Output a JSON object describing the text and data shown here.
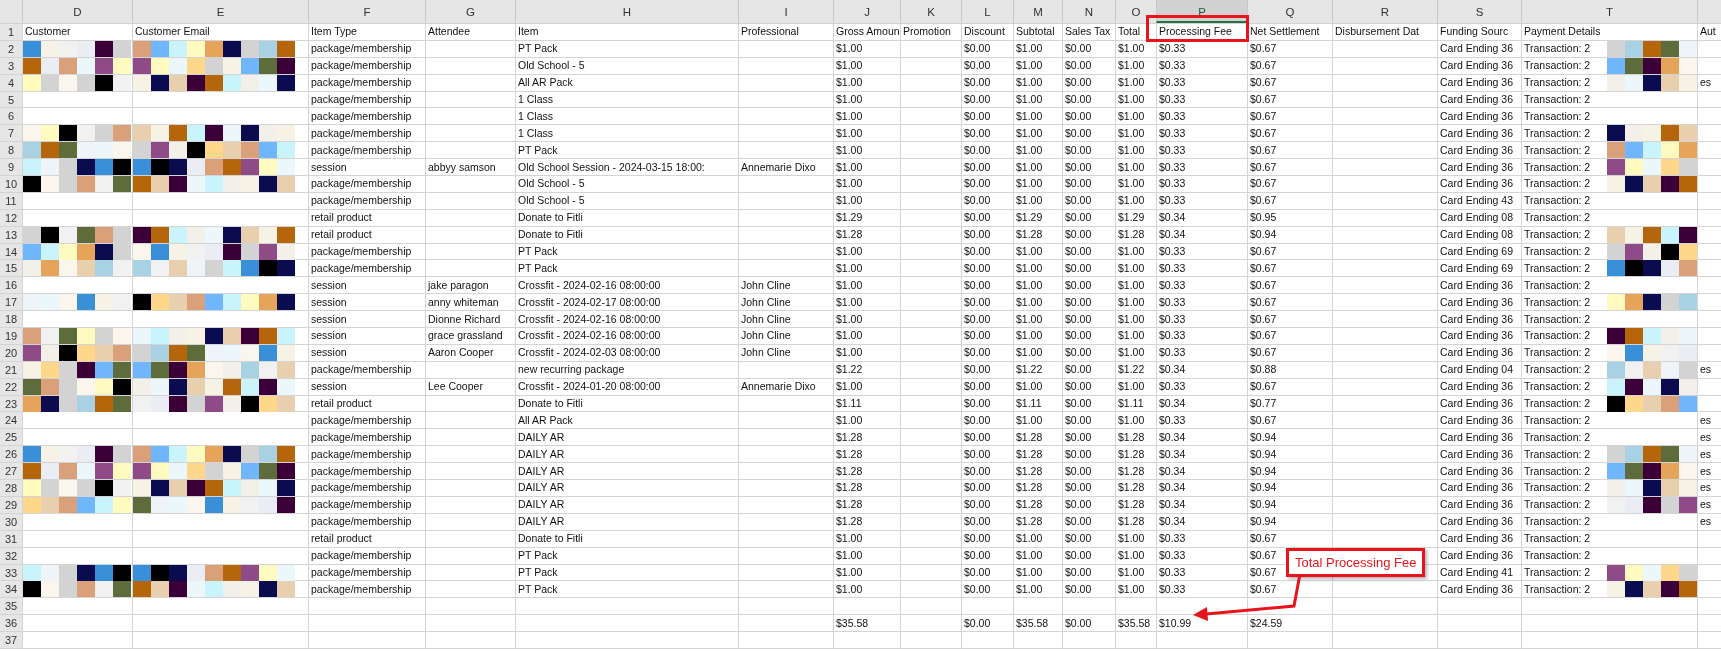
{
  "column_letters": [
    {
      "label": "D",
      "selected": false
    },
    {
      "label": "E",
      "selected": false
    },
    {
      "label": "F",
      "selected": false
    },
    {
      "label": "G",
      "selected": false
    },
    {
      "label": "H",
      "selected": false
    },
    {
      "label": "I",
      "selected": false
    },
    {
      "label": "J",
      "selected": false
    },
    {
      "label": "K",
      "selected": false
    },
    {
      "label": "L",
      "selected": false
    },
    {
      "label": "M",
      "selected": false
    },
    {
      "label": "N",
      "selected": false
    },
    {
      "label": "O",
      "selected": false
    },
    {
      "label": "P",
      "selected": true
    },
    {
      "label": "Q",
      "selected": false
    },
    {
      "label": "R",
      "selected": false
    },
    {
      "label": "S",
      "selected": false
    },
    {
      "label": "T",
      "selected": false
    }
  ],
  "header_row": {
    "number": "1",
    "customer": "Customer",
    "customer_email": "Customer Email",
    "item_type": "Item Type",
    "attendee": "Attendee",
    "item": "Item",
    "professional": "Professional",
    "gross_amount": "Gross Amoun",
    "promotion": "Promotion",
    "discount": "Discount",
    "subtotal": "Subtotal",
    "sales_tax": "Sales Tax",
    "total": "Total",
    "processing_fee": "Processing Fee",
    "net_settlement": "Net Settlement",
    "disbursement_date": "Disbursement Dat",
    "funding_source": "Funding Sourc",
    "payment_details": "Payment Details",
    "column_u": "Aut"
  },
  "rows": [
    {
      "number": "2",
      "redacted": true,
      "item_type": "package/membership",
      "item": "PT Pack",
      "gross_amount": "$1.00",
      "discount": "$0.00",
      "subtotal": "$1.00",
      "sales_tax": "$0.00",
      "total": "$1.00",
      "processing_fee": "$0.33",
      "net_settlement": "$0.67",
      "funding_source": "Card Ending 36",
      "payment_details": "Transaction: 2"
    },
    {
      "number": "3",
      "redacted": true,
      "item_type": "package/membership",
      "item": "Old School - 5",
      "gross_amount": "$1.00",
      "discount": "$0.00",
      "subtotal": "$1.00",
      "sales_tax": "$0.00",
      "total": "$1.00",
      "processing_fee": "$0.33",
      "net_settlement": "$0.67",
      "funding_source": "Card Ending 36",
      "payment_details": "Transaction: 2"
    },
    {
      "number": "4",
      "redacted": true,
      "item_type": "package/membership",
      "item": "All AR Pack",
      "gross_amount": "$1.00",
      "discount": "$0.00",
      "subtotal": "$1.00",
      "sales_tax": "$0.00",
      "total": "$1.00",
      "processing_fee": "$0.33",
      "net_settlement": "$0.67",
      "funding_source": "Card Ending 36",
      "payment_details": "Transaction: 2",
      "column_u": "es"
    },
    {
      "number": "5",
      "redacted": false,
      "item_type": "package/membership",
      "item": "1 Class",
      "gross_amount": "$1.00",
      "discount": "$0.00",
      "subtotal": "$1.00",
      "sales_tax": "$0.00",
      "total": "$1.00",
      "processing_fee": "$0.33",
      "net_settlement": "$0.67",
      "funding_source": "Card Ending 36",
      "payment_details": "Transaction: 2"
    },
    {
      "number": "6",
      "redacted": false,
      "item_type": "package/membership",
      "item": "1 Class",
      "gross_amount": "$1.00",
      "discount": "$0.00",
      "subtotal": "$1.00",
      "sales_tax": "$0.00",
      "total": "$1.00",
      "processing_fee": "$0.33",
      "net_settlement": "$0.67",
      "funding_source": "Card Ending 36",
      "payment_details": "Transaction: 2"
    },
    {
      "number": "7",
      "redacted": true,
      "item_type": "package/membership",
      "item": "1 Class",
      "gross_amount": "$1.00",
      "discount": "$0.00",
      "subtotal": "$1.00",
      "sales_tax": "$0.00",
      "total": "$1.00",
      "processing_fee": "$0.33",
      "net_settlement": "$0.67",
      "funding_source": "Card Ending 36",
      "payment_details": "Transaction: 2"
    },
    {
      "number": "8",
      "redacted": true,
      "item_type": "package/membership",
      "item": "PT Pack",
      "gross_amount": "$1.00",
      "discount": "$0.00",
      "subtotal": "$1.00",
      "sales_tax": "$0.00",
      "total": "$1.00",
      "processing_fee": "$0.33",
      "net_settlement": "$0.67",
      "funding_source": "Card Ending 36",
      "payment_details": "Transaction: 2"
    },
    {
      "number": "9",
      "redacted": true,
      "item_type": "session",
      "attendee": "abbyy samson",
      "item": "Old School Session - 2024-03-15 18:00:",
      "professional": "Annemarie Dixo",
      "gross_amount": "$1.00",
      "discount": "$0.00",
      "subtotal": "$1.00",
      "sales_tax": "$0.00",
      "total": "$1.00",
      "processing_fee": "$0.33",
      "net_settlement": "$0.67",
      "funding_source": "Card Ending 36",
      "payment_details": "Transaction: 2"
    },
    {
      "number": "10",
      "redacted": true,
      "item_type": "package/membership",
      "item": "Old School - 5",
      "gross_amount": "$1.00",
      "discount": "$0.00",
      "subtotal": "$1.00",
      "sales_tax": "$0.00",
      "total": "$1.00",
      "processing_fee": "$0.33",
      "net_settlement": "$0.67",
      "funding_source": "Card Ending 36",
      "payment_details": "Transaction: 2"
    },
    {
      "number": "11",
      "redacted": false,
      "item_type": "package/membership",
      "item": "Old School - 5",
      "gross_amount": "$1.00",
      "discount": "$0.00",
      "subtotal": "$1.00",
      "sales_tax": "$0.00",
      "total": "$1.00",
      "processing_fee": "$0.33",
      "net_settlement": "$0.67",
      "funding_source": "Card Ending 43",
      "payment_details": "Transaction: 2"
    },
    {
      "number": "12",
      "redacted": false,
      "item_type": "retail product",
      "item": "Donate to Fitli",
      "gross_amount": "$1.29",
      "discount": "$0.00",
      "subtotal": "$1.29",
      "sales_tax": "$0.00",
      "total": "$1.29",
      "processing_fee": "$0.34",
      "net_settlement": "$0.95",
      "funding_source": "Card Ending 08",
      "payment_details": "Transaction: 2"
    },
    {
      "number": "13",
      "redacted": true,
      "item_type": "retail product",
      "item": "Donate to Fitli",
      "gross_amount": "$1.28",
      "discount": "$0.00",
      "subtotal": "$1.28",
      "sales_tax": "$0.00",
      "total": "$1.28",
      "processing_fee": "$0.34",
      "net_settlement": "$0.94",
      "funding_source": "Card Ending 08",
      "payment_details": "Transaction: 2"
    },
    {
      "number": "14",
      "redacted": true,
      "item_type": "package/membership",
      "item": "PT Pack",
      "gross_amount": "$1.00",
      "discount": "$0.00",
      "subtotal": "$1.00",
      "sales_tax": "$0.00",
      "total": "$1.00",
      "processing_fee": "$0.33",
      "net_settlement": "$0.67",
      "funding_source": "Card Ending 69",
      "payment_details": "Transaction: 2"
    },
    {
      "number": "15",
      "redacted": true,
      "item_type": "package/membership",
      "item": "PT Pack",
      "gross_amount": "$1.00",
      "discount": "$0.00",
      "subtotal": "$1.00",
      "sales_tax": "$0.00",
      "total": "$1.00",
      "processing_fee": "$0.33",
      "net_settlement": "$0.67",
      "funding_source": "Card Ending 69",
      "payment_details": "Transaction: 2"
    },
    {
      "number": "16",
      "redacted": false,
      "item_type": "session",
      "attendee": "jake paragon",
      "item": "Crossfit - 2024-02-16 08:00:00",
      "professional": "John Cline",
      "gross_amount": "$1.00",
      "discount": "$0.00",
      "subtotal": "$1.00",
      "sales_tax": "$0.00",
      "total": "$1.00",
      "processing_fee": "$0.33",
      "net_settlement": "$0.67",
      "funding_source": "Card Ending 36",
      "payment_details": "Transaction: 2"
    },
    {
      "number": "17",
      "redacted": true,
      "item_type": "session",
      "attendee": "anny whiteman",
      "item": "Crossfit - 2024-02-17 08:00:00",
      "professional": "John Cline",
      "gross_amount": "$1.00",
      "discount": "$0.00",
      "subtotal": "$1.00",
      "sales_tax": "$0.00",
      "total": "$1.00",
      "processing_fee": "$0.33",
      "net_settlement": "$0.67",
      "funding_source": "Card Ending 36",
      "payment_details": "Transaction: 2"
    },
    {
      "number": "18",
      "redacted": false,
      "item_type": "session",
      "attendee": "Dionne Richard",
      "item": "Crossfit - 2024-02-16 08:00:00",
      "professional": "John Cline",
      "gross_amount": "$1.00",
      "discount": "$0.00",
      "subtotal": "$1.00",
      "sales_tax": "$0.00",
      "total": "$1.00",
      "processing_fee": "$0.33",
      "net_settlement": "$0.67",
      "funding_source": "Card Ending 36",
      "payment_details": "Transaction: 2"
    },
    {
      "number": "19",
      "redacted": true,
      "item_type": "session",
      "attendee": "grace grassland",
      "item": "Crossfit - 2024-02-16 08:00:00",
      "professional": "John Cline",
      "gross_amount": "$1.00",
      "discount": "$0.00",
      "subtotal": "$1.00",
      "sales_tax": "$0.00",
      "total": "$1.00",
      "processing_fee": "$0.33",
      "net_settlement": "$0.67",
      "funding_source": "Card Ending 36",
      "payment_details": "Transaction: 2"
    },
    {
      "number": "20",
      "redacted": true,
      "item_type": "session",
      "attendee": "Aaron Cooper",
      "item": "Crossfit - 2024-02-03 08:00:00",
      "professional": "John Cline",
      "gross_amount": "$1.00",
      "discount": "$0.00",
      "subtotal": "$1.00",
      "sales_tax": "$0.00",
      "total": "$1.00",
      "processing_fee": "$0.33",
      "net_settlement": "$0.67",
      "funding_source": "Card Ending 36",
      "payment_details": "Transaction: 2"
    },
    {
      "number": "21",
      "redacted": true,
      "item_type": "package/membership",
      "item": "new recurring package",
      "gross_amount": "$1.22",
      "discount": "$0.00",
      "subtotal": "$1.22",
      "sales_tax": "$0.00",
      "total": "$1.22",
      "processing_fee": "$0.34",
      "net_settlement": "$0.88",
      "funding_source": "Card Ending 04",
      "payment_details": "Transaction: 2",
      "column_u": "es"
    },
    {
      "number": "22",
      "redacted": true,
      "item_type": "session",
      "attendee": "Lee Cooper",
      "item": "Crossfit - 2024-01-20 08:00:00",
      "professional": "Annemarie Dixo",
      "gross_amount": "$1.00",
      "discount": "$0.00",
      "subtotal": "$1.00",
      "sales_tax": "$0.00",
      "total": "$1.00",
      "processing_fee": "$0.33",
      "net_settlement": "$0.67",
      "funding_source": "Card Ending 36",
      "payment_details": "Transaction: 2"
    },
    {
      "number": "23",
      "redacted": true,
      "item_type": "retail product",
      "item": "Donate to Fitli",
      "gross_amount": "$1.11",
      "discount": "$0.00",
      "subtotal": "$1.11",
      "sales_tax": "$0.00",
      "total": "$1.11",
      "processing_fee": "$0.34",
      "net_settlement": "$0.77",
      "funding_source": "Card Ending 36",
      "payment_details": "Transaction: 2"
    },
    {
      "number": "24",
      "redacted": false,
      "item_type": "package/membership",
      "item": "All AR Pack",
      "gross_amount": "$1.00",
      "discount": "$0.00",
      "subtotal": "$1.00",
      "sales_tax": "$0.00",
      "total": "$1.00",
      "processing_fee": "$0.33",
      "net_settlement": "$0.67",
      "funding_source": "Card Ending 36",
      "payment_details": "Transaction: 2",
      "column_u": "es"
    },
    {
      "number": "25",
      "redacted": false,
      "item_type": "package/membership",
      "item": "DAILY AR",
      "gross_amount": "$1.28",
      "discount": "$0.00",
      "subtotal": "$1.28",
      "sales_tax": "$0.00",
      "total": "$1.28",
      "processing_fee": "$0.34",
      "net_settlement": "$0.94",
      "funding_source": "Card Ending 36",
      "payment_details": "Transaction: 2",
      "column_u": "es"
    },
    {
      "number": "26",
      "redacted": true,
      "item_type": "package/membership",
      "item": "DAILY AR",
      "gross_amount": "$1.28",
      "discount": "$0.00",
      "subtotal": "$1.28",
      "sales_tax": "$0.00",
      "total": "$1.28",
      "processing_fee": "$0.34",
      "net_settlement": "$0.94",
      "funding_source": "Card Ending 36",
      "payment_details": "Transaction: 2",
      "column_u": "es"
    },
    {
      "number": "27",
      "redacted": true,
      "item_type": "package/membership",
      "item": "DAILY AR",
      "gross_amount": "$1.28",
      "discount": "$0.00",
      "subtotal": "$1.28",
      "sales_tax": "$0.00",
      "total": "$1.28",
      "processing_fee": "$0.34",
      "net_settlement": "$0.94",
      "funding_source": "Card Ending 36",
      "payment_details": "Transaction: 2",
      "column_u": "es"
    },
    {
      "number": "28",
      "redacted": true,
      "item_type": "package/membership",
      "item": "DAILY AR",
      "gross_amount": "$1.28",
      "discount": "$0.00",
      "subtotal": "$1.28",
      "sales_tax": "$0.00",
      "total": "$1.28",
      "processing_fee": "$0.34",
      "net_settlement": "$0.94",
      "funding_source": "Card Ending 36",
      "payment_details": "Transaction: 2",
      "column_u": "es"
    },
    {
      "number": "29",
      "redacted": true,
      "item_type": "package/membership",
      "item": "DAILY AR",
      "gross_amount": "$1.28",
      "discount": "$0.00",
      "subtotal": "$1.28",
      "sales_tax": "$0.00",
      "total": "$1.28",
      "processing_fee": "$0.34",
      "net_settlement": "$0.94",
      "funding_source": "Card Ending 36",
      "payment_details": "Transaction: 2",
      "column_u": "es"
    },
    {
      "number": "30",
      "redacted": false,
      "item_type": "package/membership",
      "item": "DAILY AR",
      "gross_amount": "$1.28",
      "discount": "$0.00",
      "subtotal": "$1.28",
      "sales_tax": "$0.00",
      "total": "$1.28",
      "processing_fee": "$0.34",
      "net_settlement": "$0.94",
      "funding_source": "Card Ending 36",
      "payment_details": "Transaction: 2",
      "column_u": "es"
    },
    {
      "number": "31",
      "redacted": false,
      "item_type": "retail product",
      "item": "Donate to Fitli",
      "gross_amount": "$1.00",
      "discount": "$0.00",
      "subtotal": "$1.00",
      "sales_tax": "$0.00",
      "total": "$1.00",
      "processing_fee": "$0.33",
      "net_settlement": "$0.67",
      "funding_source": "Card Ending 36",
      "payment_details": "Transaction: 2"
    },
    {
      "number": "32",
      "redacted": false,
      "item_type": "package/membership",
      "item": "PT Pack",
      "gross_amount": "$1.00",
      "discount": "$0.00",
      "subtotal": "$1.00",
      "sales_tax": "$0.00",
      "total": "$1.00",
      "processing_fee": "$0.33",
      "net_settlement": "$0.67",
      "funding_source": "Card Ending 36",
      "payment_details": "Transaction: 2"
    },
    {
      "number": "33",
      "redacted": true,
      "item_type": "package/membership",
      "item": "PT Pack",
      "gross_amount": "$1.00",
      "discount": "$0.00",
      "subtotal": "$1.00",
      "sales_tax": "$0.00",
      "total": "$1.00",
      "processing_fee": "$0.33",
      "net_settlement": "$0.67",
      "funding_source": "Card Ending 41",
      "payment_details": "Transaction: 2"
    },
    {
      "number": "34",
      "redacted": true,
      "item_type": "package/membership",
      "item": "PT Pack",
      "gross_amount": "$1.00",
      "discount": "$0.00",
      "subtotal": "$1.00",
      "sales_tax": "$0.00",
      "total": "$1.00",
      "processing_fee": "$0.33",
      "net_settlement": "$0.67",
      "funding_source": "Card Ending 36",
      "payment_details": "Transaction: 2"
    },
    {
      "number": "35",
      "redacted": false
    },
    {
      "number": "36",
      "redacted": false,
      "gross_amount": "$35.58",
      "discount": "$0.00",
      "subtotal": "$35.58",
      "sales_tax": "$0.00",
      "total": "$35.58",
      "processing_fee": "$10.99",
      "net_settlement": "$24.59"
    },
    {
      "number": "37",
      "redacted": false
    }
  ],
  "callout": {
    "text": "Total Processing Fee"
  }
}
